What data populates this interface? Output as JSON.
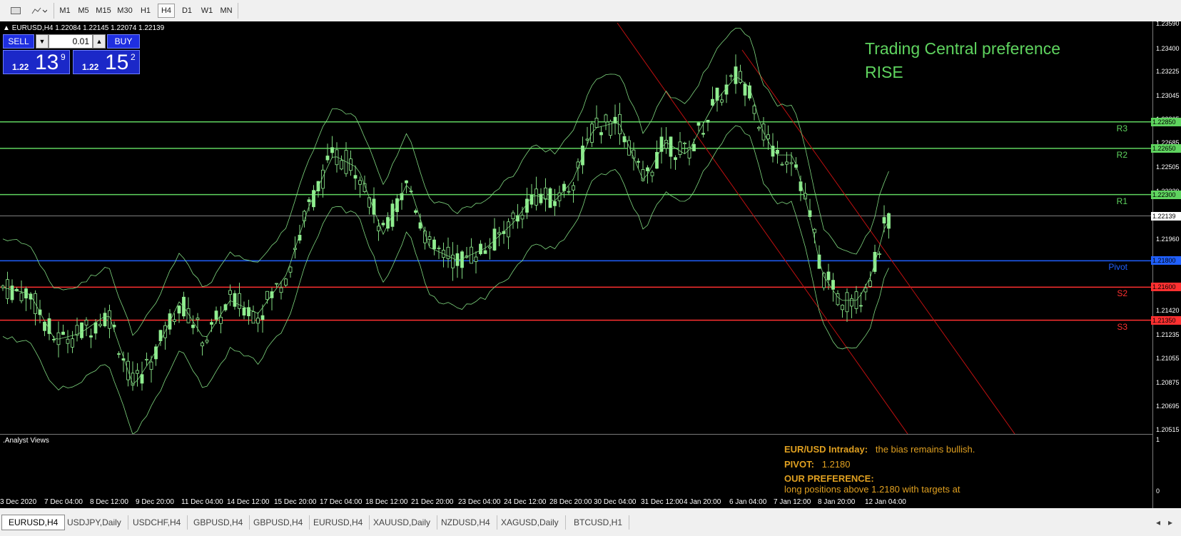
{
  "toolbar": {
    "timeframes": [
      "M1",
      "M5",
      "M15",
      "M30",
      "H1",
      "H4",
      "D1",
      "W1",
      "MN"
    ],
    "active_timeframe": "H4"
  },
  "chart": {
    "symbol_info": "EURUSD,H4  1.22084 1.22145 1.22074 1.22139",
    "trade_panel": {
      "sell_label": "SELL",
      "buy_label": "BUY",
      "lot_value": "0.01",
      "sell_price_prefix": "1.22",
      "sell_price_big": "13",
      "sell_price_sup": "9",
      "buy_price_prefix": "1.22",
      "buy_price_big": "15",
      "buy_price_sup": "2"
    },
    "headline_line1": "Trading Central preference",
    "headline_line2": "RISE",
    "price_axis": [
      "1.23590",
      "1.23400",
      "1.23225",
      "1.23045",
      "1.22865",
      "1.22685",
      "1.22505",
      "1.22320",
      "1.22139",
      "1.21960",
      "1.21780",
      "1.21600",
      "1.21420",
      "1.21235",
      "1.21055",
      "1.20875",
      "1.20695",
      "1.20515"
    ],
    "levels": [
      {
        "name": "R3",
        "price": "1.22850",
        "color": "#5fd45f"
      },
      {
        "name": "R2",
        "price": "1.22650",
        "color": "#5fd45f"
      },
      {
        "name": "R1",
        "price": "1.22300",
        "color": "#5fd45f"
      },
      {
        "name": "Pivot",
        "price": "1.21800",
        "color": "#2060ff"
      },
      {
        "name": "S2",
        "price": "1.21600",
        "color": "#ff3030"
      },
      {
        "name": "S3",
        "price": "1.21350",
        "color": "#ff3030"
      }
    ],
    "current_price": "1.22139",
    "time_axis": [
      "3 Dec 2020",
      "7 Dec 04:00",
      "8 Dec 12:00",
      "9 Dec 20:00",
      "11 Dec 04:00",
      "14 Dec 12:00",
      "15 Dec 20:00",
      "17 Dec 04:00",
      "18 Dec 12:00",
      "21 Dec 20:00",
      "23 Dec 04:00",
      "24 Dec 12:00",
      "28 Dec 20:00",
      "30 Dec 04:00",
      "31 Dec 12:00",
      "4 Jan 20:00",
      "6 Jan 04:00",
      "7 Jan 12:00",
      "8 Jan 20:00",
      "12 Jan 04:00"
    ]
  },
  "analyst": {
    "title": ".Analyst Views",
    "axis_top": "1",
    "axis_bottom": "0",
    "line1_label": "EUR/USD Intraday:",
    "line1_text": "the bias remains bullish.",
    "line2_label": "PIVOT:",
    "line2_text": "1.2180",
    "line3_label": "OUR PREFERENCE:",
    "line4_text": "long positions above 1.2180 with targets at"
  },
  "tabs": [
    "EURUSD,H4",
    "USDJPY,Daily",
    "USDCHF,H4",
    "GBPUSD,H4",
    "GBPUSD,H4",
    "EURUSD,H4",
    "XAUUSD,Daily",
    "NZDUSD,H4",
    "XAGUSD,Daily",
    "BTCUSD,H1"
  ],
  "active_tab": "EURUSD,H4",
  "colors": {
    "bull": "#90ee90",
    "bands": "#7fd77f",
    "trend": "#c01010",
    "accent_text": "#e0a020"
  }
}
